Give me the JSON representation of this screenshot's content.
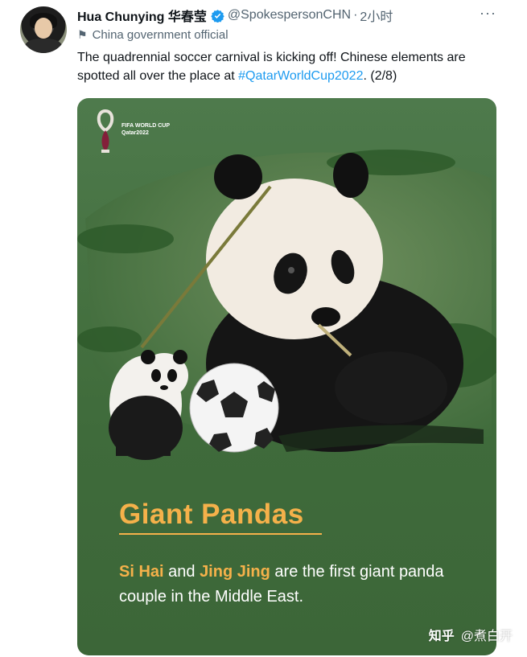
{
  "tweet": {
    "author_name": "Hua Chunying 华春莹",
    "handle": "@SpokespersonCHN",
    "separator": "·",
    "time": "2小时",
    "more": "···",
    "account_label": "China government official",
    "text_before": "The quadrennial soccer carnival is kicking off! Chinese elements are spotted all over the place at ",
    "hashtag": "#QatarWorldCup2022",
    "text_after": ". (2/8)"
  },
  "card": {
    "logo_line1": "FIFA WORLD CUP",
    "logo_line2": "Qatar2022",
    "title": "Giant Pandas",
    "name1": "Si Hai",
    "and": " and ",
    "name2": "Jing Jing",
    "desc_rest": " are the first giant panda couple in the Middle East."
  },
  "watermark": {
    "brand": "知乎",
    "user": "@煮白开"
  },
  "icons": [
    "verified-badge-icon",
    "flag-icon",
    "more-options-icon",
    "fifa-trophy-icon"
  ],
  "colors": {
    "accent_blue": "#1d9bf0",
    "card_green": "#44703f",
    "title_orange": "#f5b14a"
  }
}
